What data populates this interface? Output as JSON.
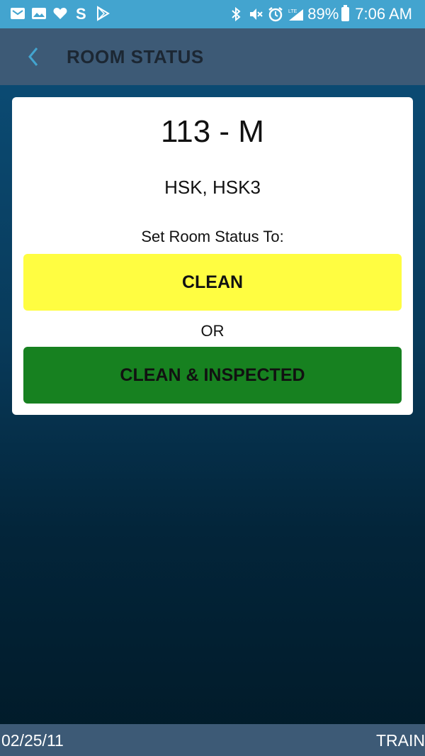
{
  "status_bar": {
    "left_icons": [
      "gallery-mail-icon",
      "image-icon",
      "heart-icon",
      "s-app-icon",
      "play-store-icon"
    ],
    "right_icons": [
      "bluetooth-icon",
      "mute-icon",
      "alarm-icon",
      "lte-signal-icon"
    ],
    "network_label": "LTE",
    "battery_percent": "89%",
    "time": "7:06 AM"
  },
  "header": {
    "back_icon": "chevron-left-icon",
    "title": "ROOM STATUS"
  },
  "room": {
    "number": "113 - M",
    "groups": "HSK, HSK3",
    "prompt": "Set Room Status To:",
    "clean_label": "CLEAN",
    "or_label": "OR",
    "inspected_label": "CLEAN & INSPECTED"
  },
  "footer": {
    "date": "02/25/11",
    "mode": "TRAIN"
  },
  "colors": {
    "status_bar": "#43a4cf",
    "header": "#3d5a76",
    "clean_button": "#fffd41",
    "inspected_button": "#178120",
    "back_chevron": "#43a4cf"
  }
}
